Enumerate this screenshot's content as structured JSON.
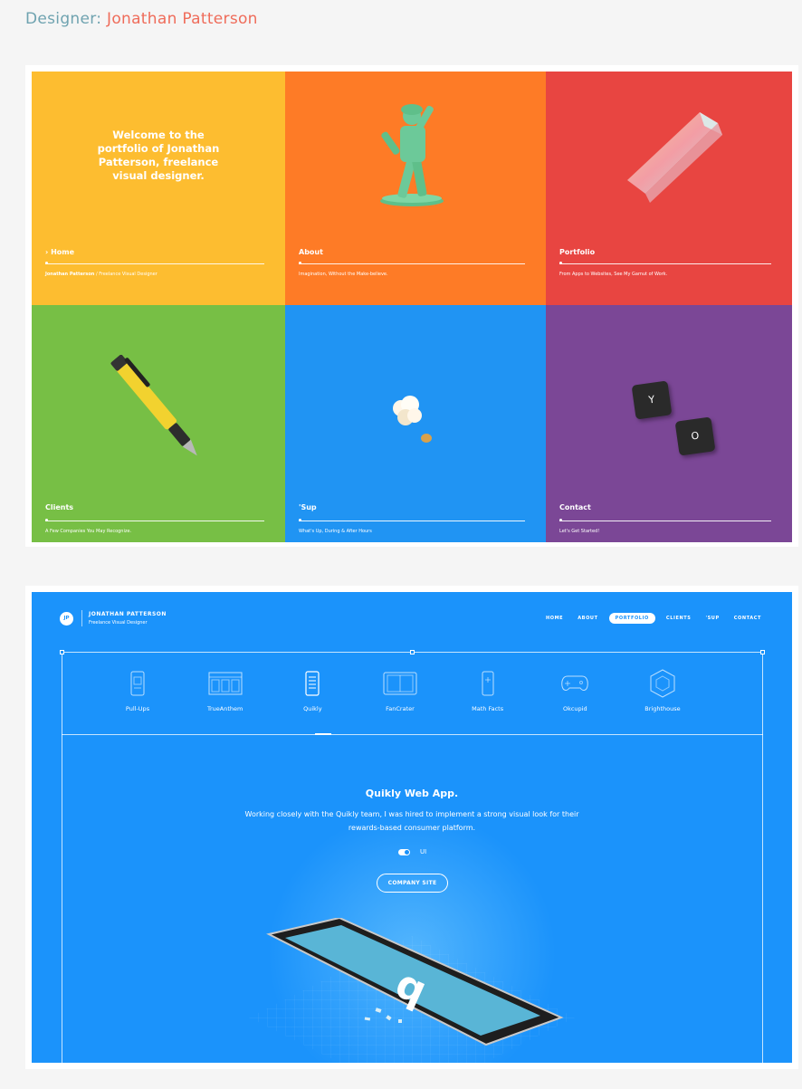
{
  "header": {
    "label": "Designer:",
    "name": "Jonathan Patterson"
  },
  "tiles": [
    {
      "id": "home",
      "title": "› Home",
      "sub_bold": "Jonathan Patterson",
      "sub_rest": " / Freelance Visual Designer"
    },
    {
      "id": "about",
      "title": "About",
      "sub": "Imagination, Without the Make-believe."
    },
    {
      "id": "portfolio",
      "title": "Portfolio",
      "sub": "From Apps to Websites, See My Gamut of Work."
    },
    {
      "id": "clients",
      "title": "Clients",
      "sub": "A Few Companies You May Recognize."
    },
    {
      "id": "sup",
      "title": "'Sup",
      "sub": "What's Up, During & After Hours"
    },
    {
      "id": "contact",
      "title": "Contact",
      "sub": "Let's Get Started!"
    }
  ],
  "welcome": "Welcome to the portfolio of Jonathan Patterson, freelance visual designer.",
  "keys": {
    "k1": "Y",
    "k2": "O"
  },
  "site": {
    "logo_mark": "JP",
    "logo_name": "JONATHAN PATTERSON",
    "logo_role": "Freelance Visual Designer",
    "nav": [
      "HOME",
      "ABOUT",
      "PORTFOLIO",
      "CLIENTS",
      "'SUP",
      "CONTACT"
    ],
    "nav_active": "PORTFOLIO",
    "projects": [
      {
        "label": "Pull-Ups",
        "icon": "phone-icon"
      },
      {
        "label": "TrueAnthem",
        "icon": "dashboard-icon"
      },
      {
        "label": "Quikly",
        "icon": "phone-list-icon"
      },
      {
        "label": "FanCrater",
        "icon": "tablet-icon"
      },
      {
        "label": "Math Facts",
        "icon": "phone-small-icon"
      },
      {
        "label": "Okcupid",
        "icon": "gamepad-icon"
      },
      {
        "label": "Brighthouse",
        "icon": "hexagon-icon"
      }
    ],
    "active_project": "Quikly",
    "app_title": "Quikly Web App.",
    "app_desc": "Working closely with the Quikly team, I was hired to implement a strong visual look for their rewards-based consumer platform.",
    "toggle_label": "UI",
    "cta": "COMPANY SITE"
  },
  "colors": {
    "yellow": "#fdbd30",
    "orange": "#fe7b26",
    "red": "#e84541",
    "green": "#77bf45",
    "blue": "#2094f3",
    "purple": "#7b4796",
    "site_blue": "#1b93fb"
  }
}
